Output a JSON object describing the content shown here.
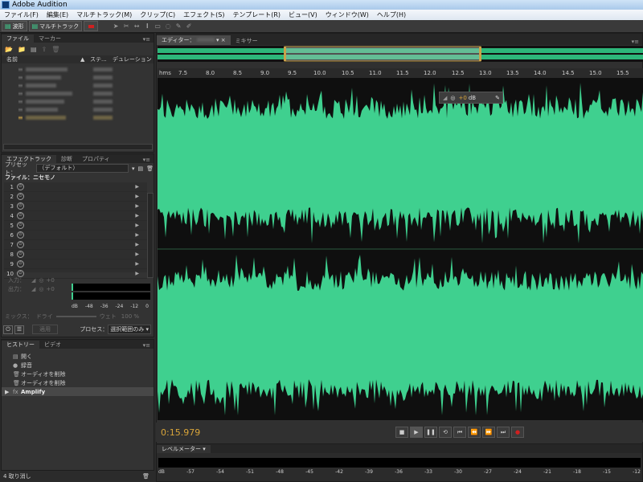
{
  "window": {
    "title": "Adobe Audition"
  },
  "menu": [
    "ファイル(F)",
    "編集(E)",
    "マルチトラック(M)",
    "クリップ(C)",
    "エフェクト(S)",
    "テンプレート(R)",
    "ビュー(V)",
    "ウィンドウ(W)",
    "ヘルプ(H)"
  ],
  "toolbar": {
    "waveform_label": "波形",
    "multitrack_label": "マルチトラック"
  },
  "files_panel": {
    "tabs": [
      "ファイル",
      "マーカー"
    ],
    "columns": {
      "name": "名前",
      "status": "ステ...",
      "duration": "デュレーション"
    }
  },
  "effects_panel": {
    "tabs": [
      "エフェクトラック",
      "診断",
      "プロパティ"
    ],
    "preset_label": "プリセット：",
    "preset_value": "（デフォルト）",
    "file_label": "ファイル：ニセモノ",
    "slots": [
      "1",
      "2",
      "3",
      "4",
      "5",
      "6",
      "7",
      "8",
      "9",
      "10"
    ],
    "input_label": "入力：",
    "output_label": "出力：",
    "gain_in": "+0",
    "gain_out": "+0",
    "meter_scale": [
      "dB",
      "-48",
      "-36",
      "-24",
      "-12",
      "0"
    ],
    "mix_label": "ミックス：",
    "dry_label": "ドライ",
    "wet_label": "ウェト",
    "wet_value": "100 %",
    "apply_label": "適用",
    "process_label": "プロセス：",
    "process_value": "選択範囲のみ"
  },
  "history_panel": {
    "tabs": [
      "ヒストリー",
      "ビデオ"
    ],
    "items": [
      {
        "icon": "open-icon",
        "label": "開く"
      },
      {
        "icon": "record-icon",
        "label": "録音"
      },
      {
        "icon": "trash-icon",
        "label": "オーディオを削除"
      },
      {
        "icon": "trash-icon",
        "label": "オーディオを削除"
      },
      {
        "icon": "fx-icon",
        "label": "Amplify"
      }
    ],
    "status": "4 取り消し"
  },
  "editor": {
    "tabs": [
      "エディター：",
      "ミキサー"
    ],
    "ruler_unit": "hms",
    "ruler_ticks": [
      "7.5",
      "8.0",
      "8.5",
      "9.0",
      "9.5",
      "10.0",
      "10.5",
      "11.0",
      "11.5",
      "12.0",
      "12.5",
      "13.0",
      "13.5",
      "14.0",
      "14.5",
      "15.0",
      "15.5"
    ],
    "hud_gain": "+0",
    "hud_unit": "dB",
    "time": "0:15.979"
  },
  "levels_panel": {
    "tab": "レベルメーター",
    "scale": [
      "dB",
      "-57",
      "-54",
      "-51",
      "-48",
      "-45",
      "-42",
      "-39",
      "-36",
      "-33",
      "-30",
      "-27",
      "-24",
      "-21",
      "-18",
      "-15",
      "-12"
    ]
  },
  "colors": {
    "waveform": "#3fd08f",
    "time": "#d9a53a",
    "record": "#d02020"
  }
}
